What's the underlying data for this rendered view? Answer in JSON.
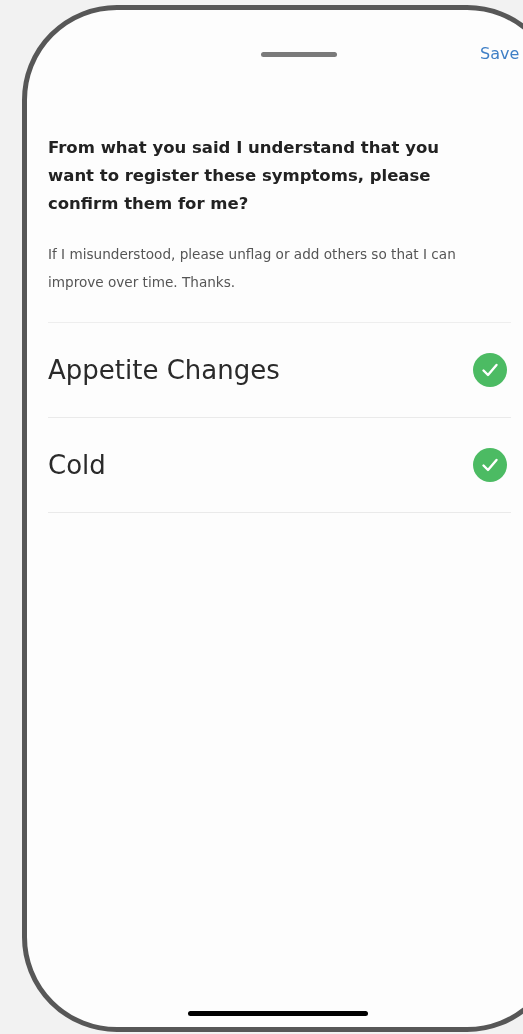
{
  "header": {
    "save": "Save"
  },
  "prompt": {
    "question": "From what you said I understand that you want to register these symptoms, please confirm them for me?",
    "note": "If I misunderstood, please unflag or add others so that I can improve over time. Thanks."
  },
  "symptoms": [
    {
      "label": "Appetite Changes",
      "checked": true
    },
    {
      "label": "Cold",
      "checked": true
    }
  ]
}
